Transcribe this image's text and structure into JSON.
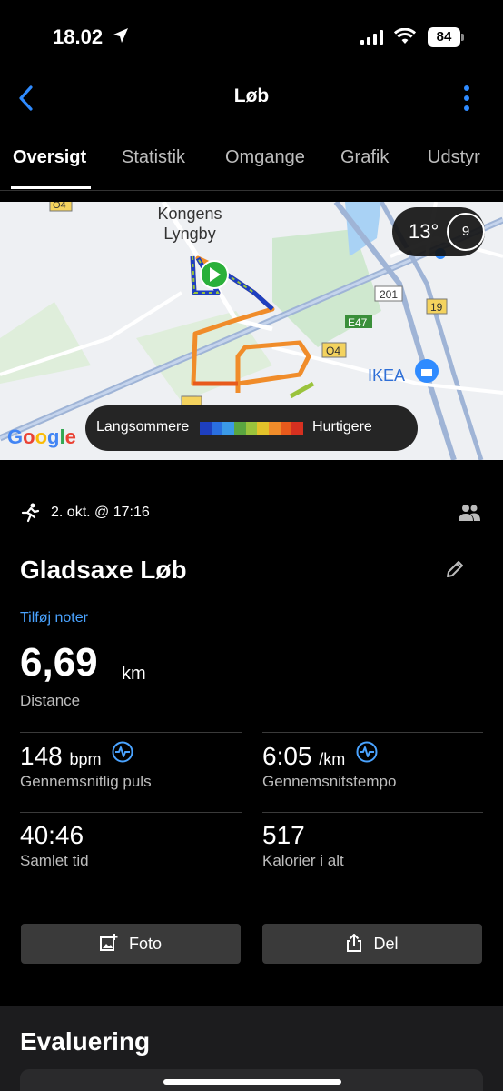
{
  "status_bar": {
    "time": "18.02",
    "battery": "84"
  },
  "nav": {
    "title": "Løb",
    "back_icon": "chevron-left-icon",
    "more_icon": "kebab-icon",
    "accent": "#2f8bff"
  },
  "tabs": [
    {
      "label": "Oversigt",
      "active": true
    },
    {
      "label": "Statistik",
      "active": false
    },
    {
      "label": "Omgange",
      "active": false
    },
    {
      "label": "Grafik",
      "active": false
    },
    {
      "label": "Udstyr",
      "active": false
    }
  ],
  "map": {
    "place": "Kongens Lyngby",
    "poi": "IKEA",
    "roads": [
      "O4",
      "201",
      "19",
      "E47",
      "O4"
    ],
    "weather_temp": "13°",
    "wind": "9",
    "legend_slow": "Langsommere",
    "legend_fast": "Hurtigere",
    "legend_colors": [
      "#1e3fbf",
      "#2a6fe0",
      "#3b9ae8",
      "#5aa640",
      "#9ac33c",
      "#e3c22a",
      "#f08c2a",
      "#e85a1c",
      "#d63020"
    ],
    "attribution": "Google"
  },
  "activity": {
    "date": "2. okt. @ 17:16",
    "title": "Gladsaxe Løb",
    "add_notes": "Tilføj noter",
    "distance_value": "6,69",
    "distance_unit": "km",
    "distance_label": "Distance"
  },
  "stats": [
    {
      "value": "148",
      "unit": "bpm",
      "label": "Gennemsnitlig puls",
      "icon": "heart-rate-icon"
    },
    {
      "value": "6:05",
      "unit": "/km",
      "label": "Gennemsnitstempo",
      "icon": "heart-rate-icon"
    },
    {
      "value": "40:46",
      "unit": "",
      "label": "Samlet tid"
    },
    {
      "value": "517",
      "unit": "",
      "label": "Kalorier i alt"
    }
  ],
  "buttons": {
    "photo": "Foto",
    "share": "Del"
  },
  "evaluation": {
    "title": "Evaluering"
  }
}
